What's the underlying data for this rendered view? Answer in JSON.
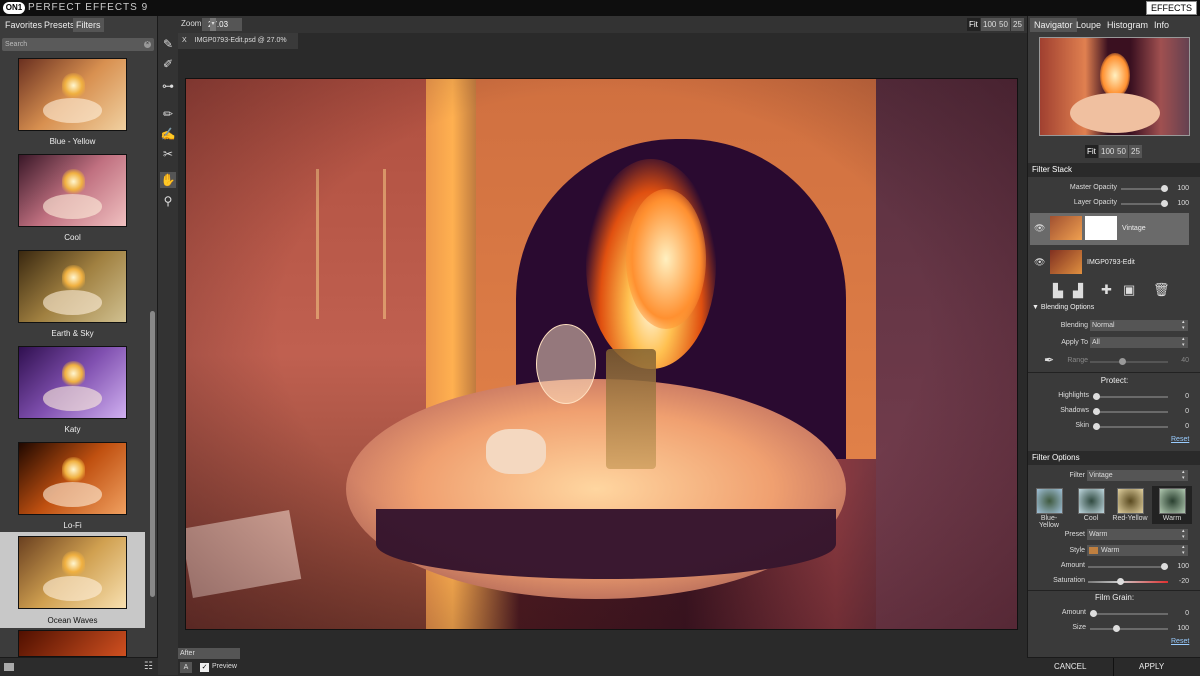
{
  "app": {
    "logo": "ON1",
    "title": "PERFECT EFFECTS 9",
    "effects_button": "EFFECTS"
  },
  "left_panel": {
    "tabs": [
      "Favorites",
      "Presets",
      "Filters"
    ],
    "search": {
      "placeholder": "Search"
    },
    "presets": [
      {
        "label": "Blue - Yellow",
        "tint": "#d89050"
      },
      {
        "label": "Cool",
        "tint": "#c07080"
      },
      {
        "label": "Earth & Sky",
        "tint": "#a08040"
      },
      {
        "label": "Katy",
        "tint": "#8050b0"
      },
      {
        "label": "Lo-Fi",
        "tint": "#c05010"
      },
      {
        "label": "Ocean Waves",
        "tint": "#d0a050"
      }
    ]
  },
  "toolbar": {
    "zoom_label": "Zoom",
    "zoom_value": "27.03",
    "zoom_buttons": [
      "Fit",
      "100",
      "50",
      "25"
    ]
  },
  "document": {
    "close": "X",
    "tab_title": "IMGP0793-Edit.psd @ 27.0% 16-bit"
  },
  "bottom": {
    "view_mode": "After",
    "ab_button": "A",
    "preview_check": "✓",
    "preview_label": "Preview"
  },
  "right_panel": {
    "tabs": [
      "Navigator",
      "Loupe",
      "Histogram",
      "Info"
    ],
    "nav_zoom_buttons": [
      "Fit",
      "100",
      "50",
      "25"
    ],
    "filter_stack": {
      "heading": "Filter Stack",
      "master_opacity": {
        "label": "Master Opacity",
        "value": "100"
      },
      "layer_opacity": {
        "label": "Layer Opacity",
        "value": "100"
      },
      "layers": [
        {
          "name": "Vintage"
        },
        {
          "name": "IMGP0793-Edit"
        }
      ]
    },
    "blending": {
      "heading": "Blending Options",
      "blending_label": "Blending",
      "blending_value": "Normal",
      "apply_to_label": "Apply To",
      "apply_to_value": "All",
      "range_label": "Range",
      "range_value": "40",
      "protect_heading": "Protect:",
      "highlights": {
        "label": "Highlights",
        "value": "0"
      },
      "shadows": {
        "label": "Shadows",
        "value": "0"
      },
      "skin": {
        "label": "Skin",
        "value": "0"
      },
      "reset": "Reset"
    },
    "filter_options": {
      "heading": "Filter Options",
      "filter_label": "Filter",
      "filter_value": "Vintage",
      "preset_thumbs": [
        "Blue-Yellow",
        "Cool",
        "Red-Yellow",
        "Warm"
      ],
      "preset_label": "Preset",
      "preset_value": "Warm",
      "style_label": "Style",
      "style_value": "Warm",
      "amount": {
        "label": "Amount",
        "value": "100"
      },
      "saturation": {
        "label": "Saturation",
        "value": "-20"
      },
      "film_grain_heading": "Film Grain:",
      "grain_amount": {
        "label": "Amount",
        "value": "0"
      },
      "grain_size": {
        "label": "Size",
        "value": "100"
      },
      "reset": "Reset"
    },
    "footer": {
      "cancel": "CANCEL",
      "apply": "APPLY"
    }
  }
}
